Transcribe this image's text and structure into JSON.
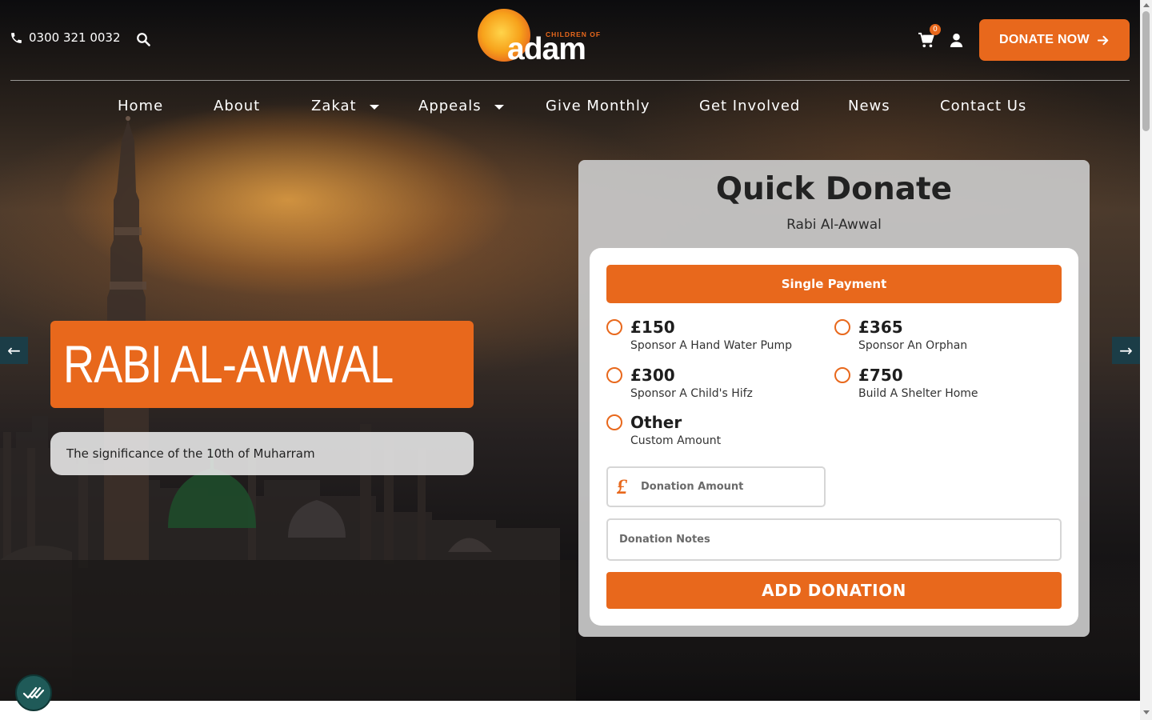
{
  "header": {
    "phone": "0300 321 0032",
    "cart_count": "0",
    "donate_now_label": "DONATE NOW",
    "logo_text": "adam",
    "logo_tagline": "CHILDREN OF"
  },
  "nav": {
    "items": [
      {
        "label": "Home",
        "has_dropdown": false
      },
      {
        "label": "About",
        "has_dropdown": false
      },
      {
        "label": "Zakat",
        "has_dropdown": true
      },
      {
        "label": "Appeals",
        "has_dropdown": true
      },
      {
        "label": "Give Monthly",
        "has_dropdown": false
      },
      {
        "label": "Get Involved",
        "has_dropdown": false
      },
      {
        "label": "News",
        "has_dropdown": false
      },
      {
        "label": "Contact Us",
        "has_dropdown": false
      }
    ]
  },
  "slider": {
    "title": "RABI AL-AWWAL",
    "subtitle": "The significance of the 10th of Muharram",
    "prev_icon": "arrow-left-icon",
    "next_icon": "arrow-right-icon"
  },
  "quick_donate": {
    "title": "Quick Donate",
    "subtitle": "Rabi Al-Awwal",
    "payment_type": "Single Payment",
    "options": [
      {
        "amount": "£150",
        "description": "Sponsor A Hand Water Pump",
        "selected": false
      },
      {
        "amount": "£365",
        "description": "Sponsor An Orphan",
        "selected": false
      },
      {
        "amount": "£300",
        "description": "Sponsor A Child's Hifz",
        "selected": false
      },
      {
        "amount": "£750",
        "description": "Build A Shelter Home",
        "selected": false
      },
      {
        "amount": "Other",
        "description": "Custom Amount",
        "selected": false
      }
    ],
    "amount_symbol": "£",
    "amount_placeholder": "Donation Amount",
    "amount_value": "",
    "notes_placeholder": "Donation Notes",
    "notes_value": "",
    "submit_label": "ADD DONATION"
  },
  "colors": {
    "accent": "#e8681c",
    "slider_arrow": "#1b3d47",
    "cookie_badge": "#1f5a58"
  }
}
